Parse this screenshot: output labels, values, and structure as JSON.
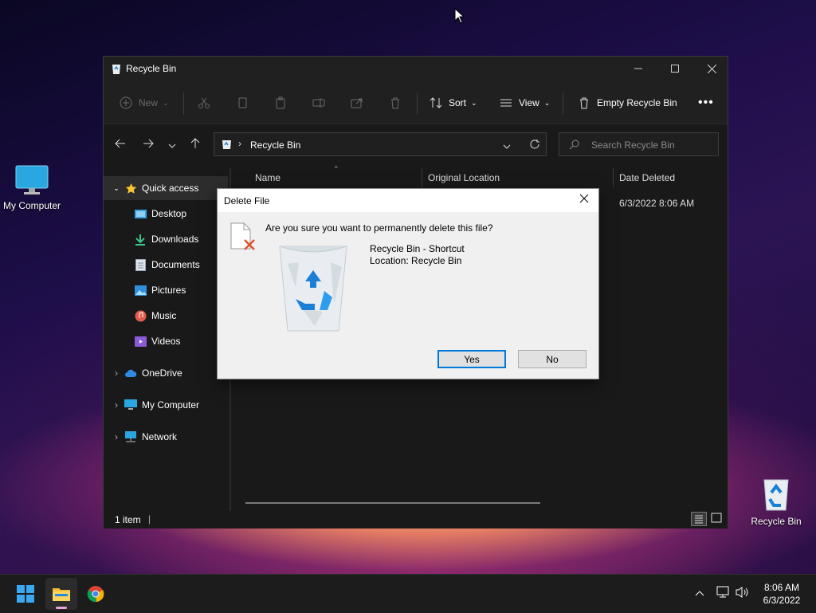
{
  "desktop": {
    "icons": [
      {
        "label": "My Computer"
      },
      {
        "label": "Recycle Bin"
      }
    ]
  },
  "window": {
    "title": "Recycle Bin",
    "toolbar": {
      "new_label": "New",
      "sort_label": "Sort",
      "view_label": "View",
      "empty_label": "Empty Recycle Bin"
    },
    "address": {
      "path": "Recycle Bin"
    },
    "search": {
      "placeholder": "Search Recycle Bin"
    },
    "sidebar": {
      "items": [
        {
          "label": "Quick access",
          "icon": "star-icon"
        },
        {
          "label": "Desktop",
          "icon": "desktop-folder-icon"
        },
        {
          "label": "Downloads",
          "icon": "download-icon"
        },
        {
          "label": "Documents",
          "icon": "documents-icon"
        },
        {
          "label": "Pictures",
          "icon": "pictures-icon"
        },
        {
          "label": "Music",
          "icon": "music-icon"
        },
        {
          "label": "Videos",
          "icon": "videos-icon"
        },
        {
          "label": "OneDrive",
          "icon": "cloud-icon"
        },
        {
          "label": "My Computer",
          "icon": "computer-icon"
        },
        {
          "label": "Network",
          "icon": "network-icon"
        }
      ]
    },
    "columns": {
      "name": "Name",
      "original_location": "Original Location",
      "date_deleted": "Date Deleted"
    },
    "rows": [
      {
        "date_deleted": "6/3/2022 8:06 AM"
      }
    ],
    "status": {
      "count": "1 item"
    }
  },
  "dialog": {
    "title": "Delete File",
    "question": "Are you sure you want to permanently delete this file?",
    "file_name": "Recycle Bin - Shortcut",
    "file_location": "Location: Recycle Bin",
    "yes_label": "Yes",
    "no_label": "No"
  },
  "taskbar": {
    "time": "8:06 AM",
    "date": "6/3/2022"
  },
  "colors": {
    "accent": "#0078d7",
    "window_bg": "#191919",
    "dialog_bg": "#f0f0f0"
  }
}
